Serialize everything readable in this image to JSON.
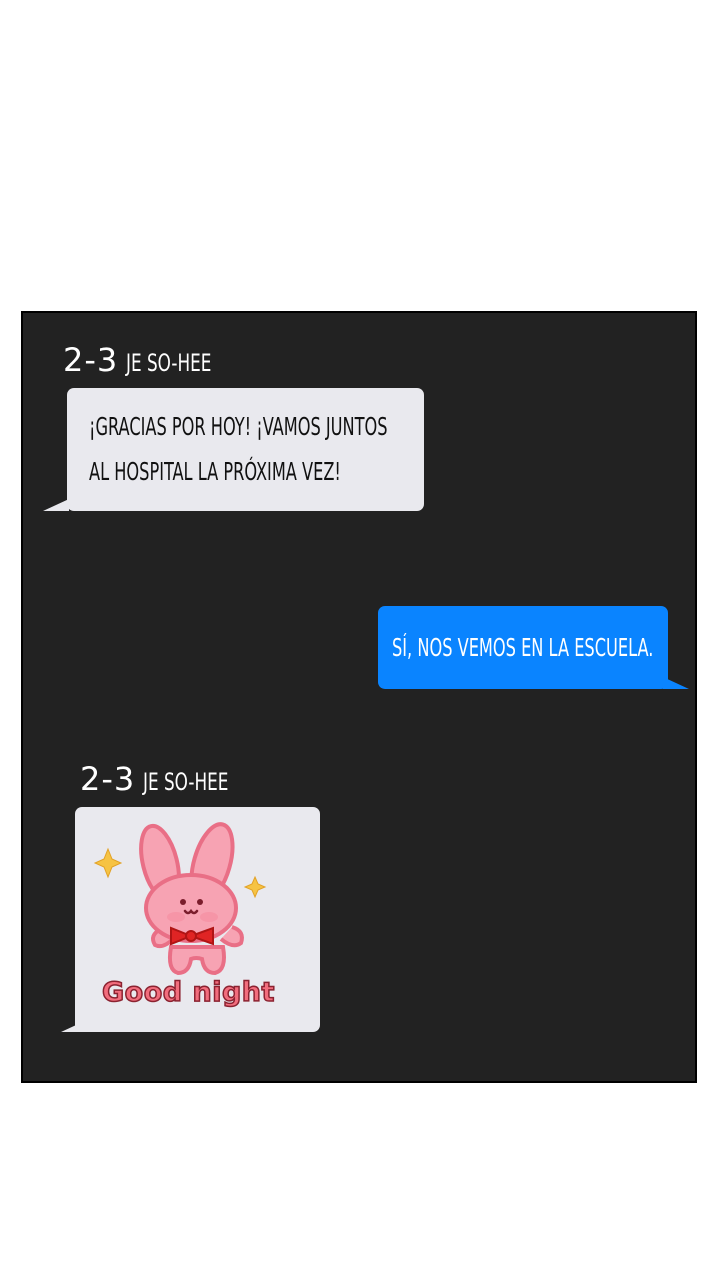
{
  "chat": {
    "messages": [
      {
        "sender_room": "2-3",
        "sender_name": "JE SO-HEE",
        "lines": [
          "¡GRACIAS POR HOY! ¡VAMOS JUNTOS",
          "AL HOSPITAL LA PRÓXIMA VEZ!"
        ]
      },
      {
        "direction": "outgoing",
        "text": "SÍ, NOS VEMOS EN LA ESCUELA."
      },
      {
        "sender_room": "2-3",
        "sender_name": "JE SO-HEE",
        "sticker": {
          "caption": "Good night",
          "icon": "pink-bunny-sticker"
        }
      }
    ]
  },
  "colors": {
    "panel_bg": "#222222",
    "incoming_bubble": "#e9e9ee",
    "outgoing_bubble": "#0a84ff",
    "bunny_pink": "#f7a3b3",
    "bunny_outline": "#e96f86",
    "bow_red": "#e02424",
    "sparkle_yellow": "#f6c343",
    "caption_pink": "#f26d7d"
  }
}
